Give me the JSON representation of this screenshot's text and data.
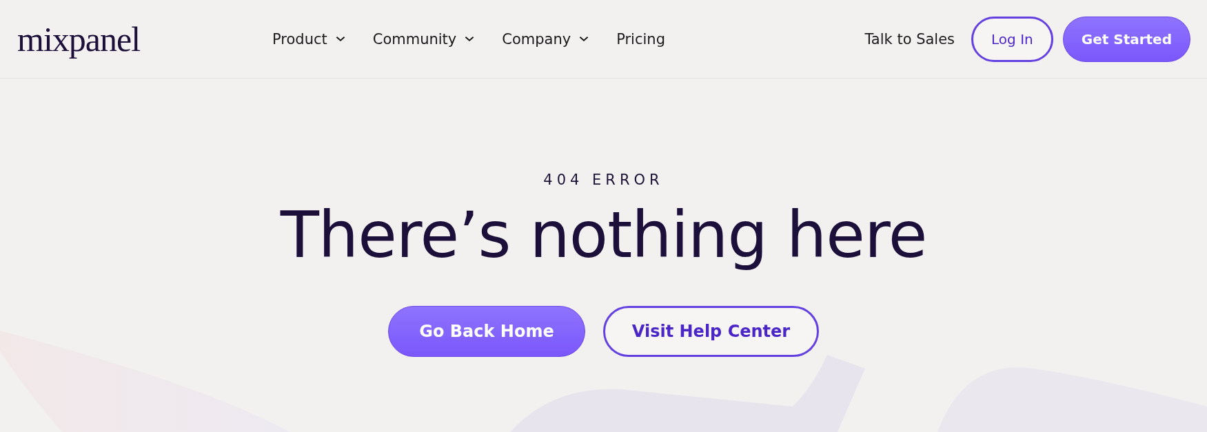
{
  "header": {
    "logo": "mixpanel",
    "nav": [
      {
        "label": "Product",
        "dropdown": true
      },
      {
        "label": "Community",
        "dropdown": true
      },
      {
        "label": "Company",
        "dropdown": true
      },
      {
        "label": "Pricing",
        "dropdown": false
      }
    ],
    "talk_to_sales": "Talk to Sales",
    "log_in": "Log In",
    "get_started": "Get Started"
  },
  "hero": {
    "eyebrow": "404 ERROR",
    "heading": "There’s nothing here",
    "primary_button": "Go Back Home",
    "secondary_button": "Visit Help Center"
  }
}
